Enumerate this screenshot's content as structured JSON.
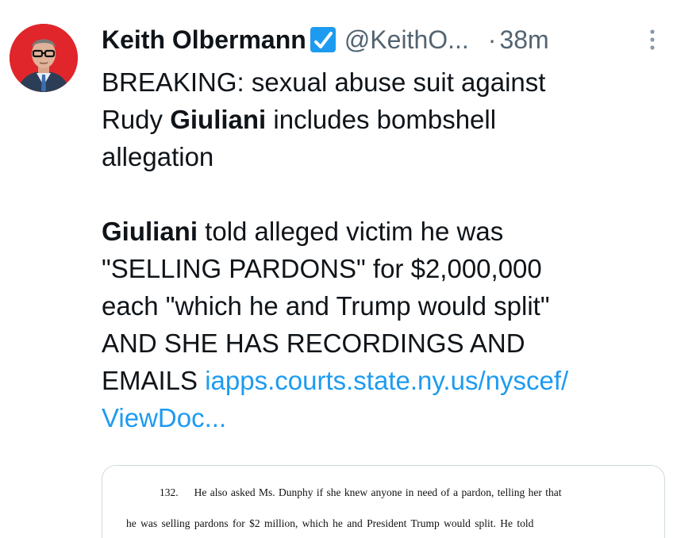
{
  "tweet": {
    "author_name": "Keith Olbermann",
    "handle": "@KeithO...",
    "separator": "·",
    "time": "38m",
    "line1_a": "BREAKING: sexual abuse suit against",
    "line2_a": "Rudy ",
    "line2_bold": "Giuliani",
    "line2_b": " includes bombshell",
    "line3": "allegation",
    "p2_bold": "Giuliani",
    "p2_a": " told alleged victim he was",
    "p2_line2": "\"SELLING PARDONS\" for $2,000,000",
    "p2_line3": "each \"which he and Trump would split\"",
    "p2_line4": "AND SHE HAS RECORDINGS AND",
    "p2_line5_a": "EMAILS ",
    "link_part1": "iapps.courts.state.ny.us/nyscef/",
    "link_part2": "ViewDoc..."
  },
  "media": {
    "paragraph_number": "132.",
    "line1": "He also asked Ms. Dunphy if she knew anyone in need of a pardon, telling her that",
    "line2": "he was selling pardons for $2 million, which he and President Trump would split.  He told"
  },
  "icons": {
    "verified": "verified-badge-icon",
    "more": "more-options-icon",
    "avatar": "profile-avatar"
  },
  "colors": {
    "link": "#1d9bf0",
    "secondary": "#536471",
    "avatar_bg": "#e0262b",
    "verified": "#1d9bf0"
  }
}
